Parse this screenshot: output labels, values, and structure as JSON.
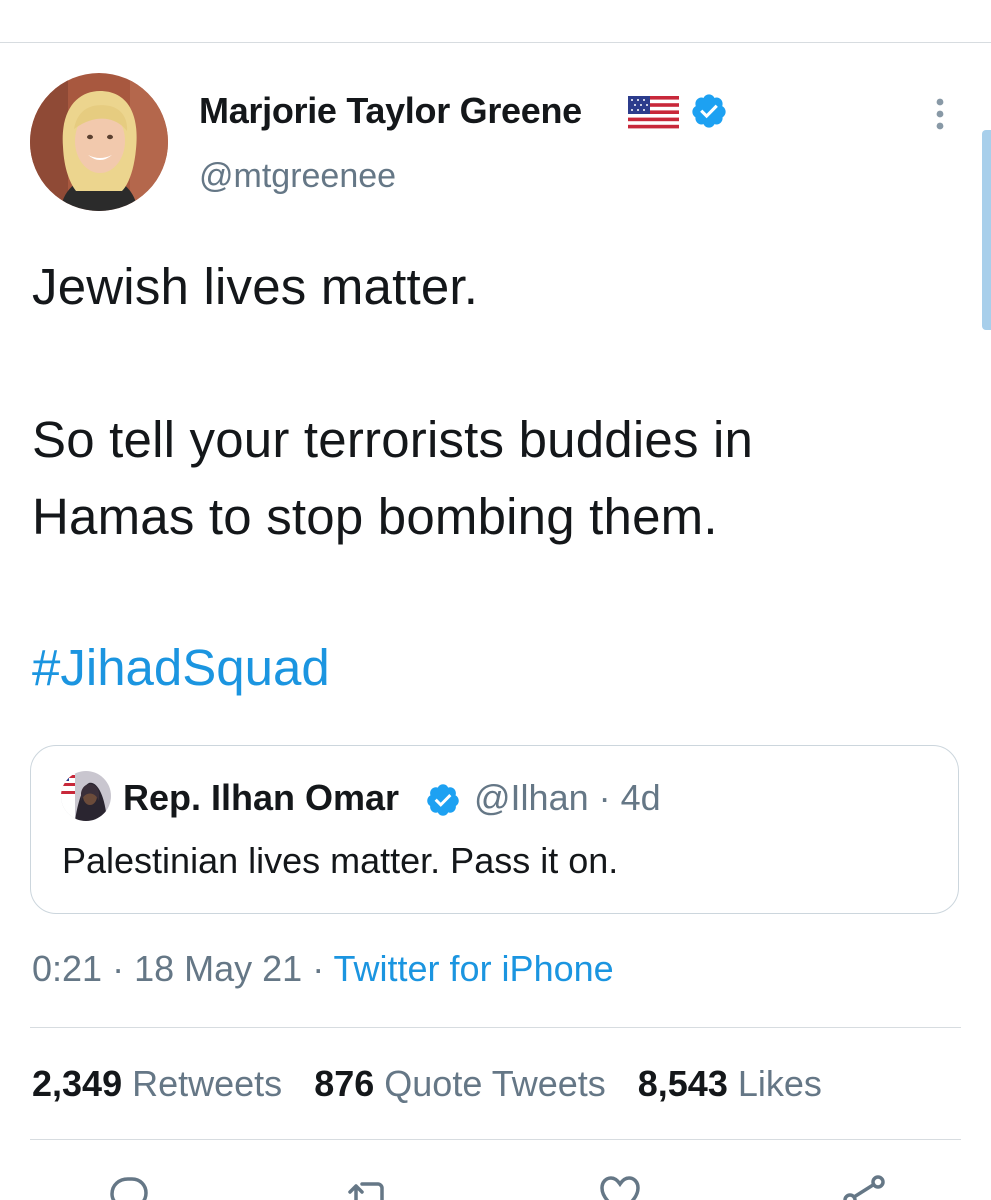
{
  "author": {
    "name": "Marjorie Taylor Greene",
    "handle": "@mtgreenee",
    "flag_emoji": "🇺🇸",
    "verified": true
  },
  "tweet": {
    "lines": [
      "Jewish lives matter.",
      "So tell your terrorists buddies in",
      "Hamas to stop bombing them."
    ],
    "hashtag": "#JihadSquad"
  },
  "quoted_tweet": {
    "name": "Rep. Ilhan Omar",
    "handle_time": "@Ilhan · 4d",
    "text": "Palestinian lives matter. Pass it on.",
    "verified": true
  },
  "meta": {
    "time": "0:21",
    "separator": " · ",
    "date": "18 May 21",
    "source": "Twitter for iPhone"
  },
  "stats": {
    "retweets_count": "2,349",
    "retweets_label": "Retweets",
    "quotes_count": "876",
    "quotes_label": "Quote Tweets",
    "likes_count": "8,543",
    "likes_label": "Likes"
  },
  "actions": [
    "reply-icon",
    "retweet-icon",
    "like-icon",
    "share-icon"
  ],
  "colors": {
    "link": "#1b95e0",
    "secondary_text": "#657786",
    "primary_text": "#14171a",
    "verified": "#1da1f2",
    "divider": "#d7dce0"
  }
}
